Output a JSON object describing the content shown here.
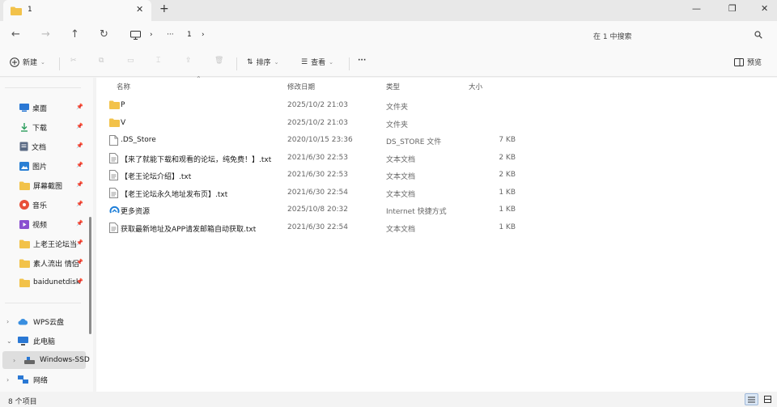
{
  "tab": {
    "title": "1",
    "close": "✕"
  },
  "window": {
    "new_tab": "+",
    "minimize": "—",
    "restore": "❐",
    "close": "✕"
  },
  "nav": {
    "back": "←",
    "forward": "→",
    "up": "↑",
    "refresh": "↻"
  },
  "breadcrumb": {
    "computer_icon": "computer-icon",
    "sep1": "›",
    "more": "···",
    "folder": "1",
    "sep2": "›"
  },
  "search": {
    "placeholder": "在 1 中搜索"
  },
  "toolbar": {
    "new_label": "新建",
    "sort_label": "排序",
    "view_label": "查看",
    "more_label": "···",
    "preview_label": "预览"
  },
  "sidebar": {
    "quick_access": [
      {
        "label": "桌面",
        "icon": "desktop-icon",
        "color": "#2a78d4"
      },
      {
        "label": "下载",
        "icon": "download-icon",
        "color": "#2a9d5c"
      },
      {
        "label": "文档",
        "icon": "document-icon",
        "color": "#5a6a84"
      },
      {
        "label": "图片",
        "icon": "picture-icon",
        "color": "#2a7fd4"
      },
      {
        "label": "屏幕截图",
        "icon": "folder-icon",
        "color": "#f2c24a"
      },
      {
        "label": "音乐",
        "icon": "music-icon",
        "color": "#e8503a"
      },
      {
        "label": "视频",
        "icon": "video-icon",
        "color": "#8a4fd0"
      },
      {
        "label": "上老王论坛当",
        "icon": "folder-icon",
        "color": "#f2c24a"
      },
      {
        "label": "素人流出 情侣",
        "icon": "folder-icon",
        "color": "#f2c24a"
      },
      {
        "label": "baidunetdisk",
        "icon": "folder-icon",
        "color": "#f2c24a"
      }
    ],
    "tree": [
      {
        "label": "WPS云盘",
        "chev": "›",
        "icon": "cloud-icon"
      },
      {
        "label": "此电脑",
        "chev": "⌄",
        "icon": "pc-icon"
      },
      {
        "label": "Windows-SSD",
        "chev": "›",
        "icon": "drive-icon"
      },
      {
        "label": "网络",
        "chev": "›",
        "icon": "network-icon"
      }
    ]
  },
  "columns": {
    "name": "名称",
    "modified": "修改日期",
    "type": "类型",
    "size": "大小"
  },
  "files": [
    {
      "name": "P",
      "modified": "2025/10/2 21:03",
      "type": "文件夹",
      "size": "",
      "icon": "folder-icon"
    },
    {
      "name": "V",
      "modified": "2025/10/2 21:03",
      "type": "文件夹",
      "size": "",
      "icon": "folder-icon"
    },
    {
      "name": ".DS_Store",
      "modified": "2020/10/15 23:36",
      "type": "DS_STORE 文件",
      "size": "7 KB",
      "icon": "file-icon"
    },
    {
      "name": "【来了就能下载和观看的论坛，纯免费！】.txt",
      "modified": "2021/6/30 22:53",
      "type": "文本文档",
      "size": "2 KB",
      "icon": "text-file-icon"
    },
    {
      "name": "【老王论坛介绍】.txt",
      "modified": "2021/6/30 22:53",
      "type": "文本文档",
      "size": "2 KB",
      "icon": "text-file-icon"
    },
    {
      "name": "【老王论坛永久地址发布页】.txt",
      "modified": "2021/6/30 22:54",
      "type": "文本文档",
      "size": "1 KB",
      "icon": "text-file-icon"
    },
    {
      "name": "更多资源",
      "modified": "2025/10/8 20:32",
      "type": "Internet 快捷方式",
      "size": "1 KB",
      "icon": "internet-shortcut-icon"
    },
    {
      "name": "获取最新地址及APP请发邮箱自动获取.txt",
      "modified": "2021/6/30 22:54",
      "type": "文本文档",
      "size": "1 KB",
      "icon": "text-file-icon"
    }
  ],
  "status": {
    "count": "8 个项目"
  },
  "colors": {
    "folder": "#f2c24a",
    "accent": "#0067c0",
    "selected": "#dedede"
  }
}
